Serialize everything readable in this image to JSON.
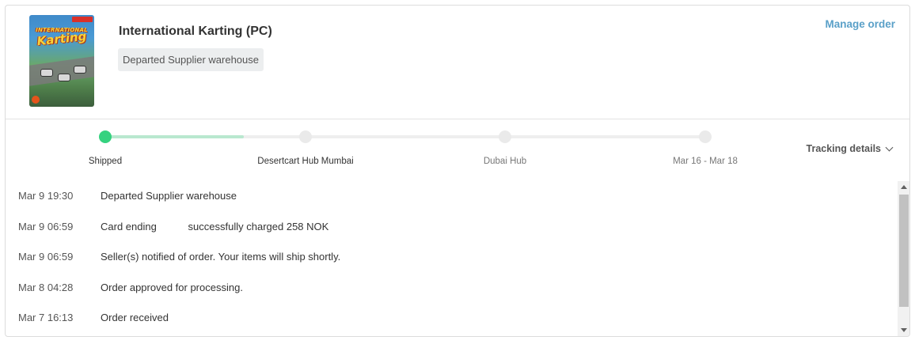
{
  "product": {
    "name": "International Karting (PC)",
    "status": "Departed Supplier warehouse",
    "cover_art_text": [
      "INTERNATIONAL",
      "Karting"
    ]
  },
  "actions": {
    "manage_order": "Manage order",
    "tracking_details": "Tracking details"
  },
  "tracker": {
    "progress": 0.23,
    "steps": [
      {
        "label": "Shipped",
        "state": "done"
      },
      {
        "label": "Desertcart Hub Mumbai",
        "state": "done"
      },
      {
        "label": "Dubai Hub",
        "state": "pending"
      },
      {
        "label": "Mar 16 - Mar 18",
        "state": "pending"
      }
    ]
  },
  "events": [
    {
      "time": "Mar 9 19:30",
      "description": "Departed Supplier warehouse"
    },
    {
      "time": "Mar 9 06:59",
      "description": "Card ending           successfully charged 258 NOK"
    },
    {
      "time": "Mar 9 06:59",
      "description": "Seller(s) notified of order. Your items will ship shortly."
    },
    {
      "time": "Mar 8 04:28",
      "description": "Order approved for processing."
    },
    {
      "time": "Mar 7 16:13",
      "description": "Order received"
    }
  ],
  "colors": {
    "accent_link": "#5aa0c8",
    "progress_active": "#35d27f",
    "progress_fill": "#b9e8cf"
  }
}
